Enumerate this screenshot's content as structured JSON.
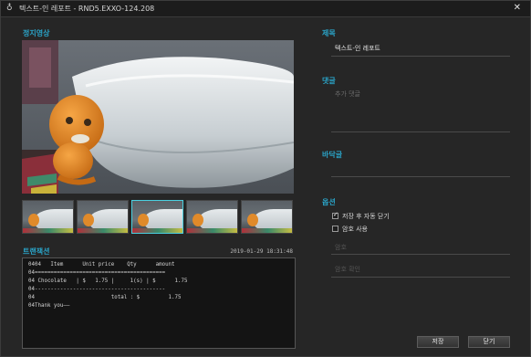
{
  "window": {
    "title": "텍스트-인 레포트 - RND5.EXXO-124.208"
  },
  "sections": {
    "still_video": "정지영상",
    "transaction": "트랜잭션"
  },
  "transaction": {
    "timestamp": "2019-01-29 18:31:48",
    "lines": [
      "0404   Item      Unit price    Qty      amount",
      "04=========================================",
      "04 Chocolate   | $   1.75 |     1(s) | $      1.75",
      "04-----------------------------------------",
      "04                        total : $         1.75",
      "04Thank you——"
    ]
  },
  "thumbnails": {
    "count": 5,
    "selected_index": 2
  },
  "form": {
    "title_label": "제목",
    "title_value": "텍스트-인 레포트",
    "comment_label": "댓글",
    "comment_placeholder": "추가 댓글",
    "footer_label": "바닥글",
    "options_label": "옵션",
    "option_autoclose": {
      "label": "저장 후 자동 닫기",
      "checked": true
    },
    "option_password": {
      "label": "암호 사용",
      "checked": false
    },
    "password_placeholder": "암호",
    "password_confirm_placeholder": "암호 확인"
  },
  "buttons": {
    "save": "저장",
    "close": "닫기"
  },
  "colors": {
    "accent": "#2aa3c7",
    "background": "#262626",
    "selected_thumb": "#4ad0e0"
  },
  "icons": {
    "app": "app-icon",
    "close": "close-icon"
  }
}
